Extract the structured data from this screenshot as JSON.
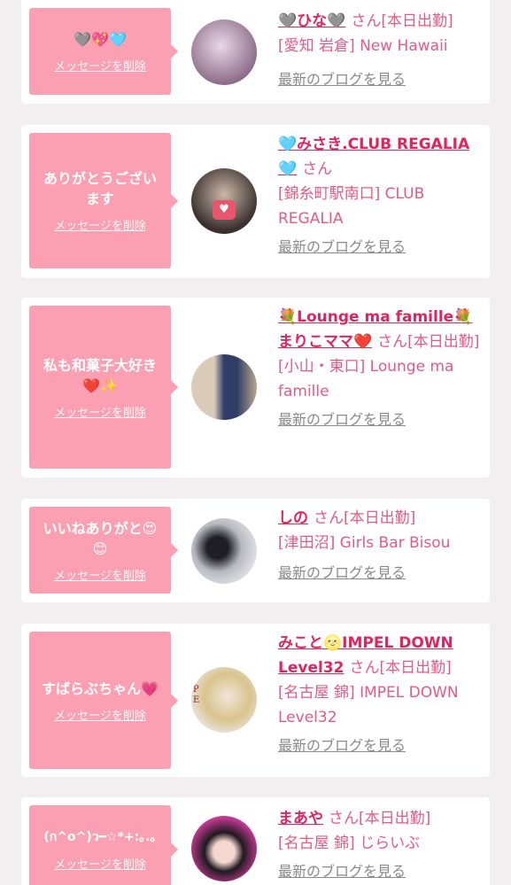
{
  "cards": [
    {
      "message": "🩶💖🩵",
      "delete": "メッセージを削除",
      "name": "🩶ひな🩶",
      "san": "さん",
      "status": "[本日出勤]",
      "shop": "[愛知 岩倉] New Hawaii",
      "blog": "最新のブログを見る",
      "avatar_color": "#b69bb4"
    },
    {
      "message": "ありがとうございます",
      "delete": "メッセージを削除",
      "name": "🩵みさき.CLUB REGALIA🩵",
      "san": "さん",
      "status": "",
      "shop": "[錦糸町駅南口] CLUB REGALIA",
      "blog": "最新のブログを見る",
      "avatar_color": "#4a4040"
    },
    {
      "message": "私も和菓子大好き❤️✨",
      "delete": "メッセージを削除",
      "name": "💐Lounge ma famille💐まりこママ❤️",
      "san": "さん",
      "status": "[本日出勤]",
      "shop": "[小山・東口] Lounge ma famille",
      "blog": "最新のブログを見る",
      "avatar_color": "#3b4a6e"
    },
    {
      "message": "いいねありがと😍😊",
      "delete": "メッセージを削除",
      "name": "しの",
      "san": "さん",
      "status": "[本日出勤]",
      "shop": "[津田沼] Girls Bar Bisou",
      "blog": "最新のブログを見る",
      "avatar_color": "#5a5a66"
    },
    {
      "message": "すばらぶちゃん💗",
      "delete": "メッセージを削除",
      "name": "みこと🌝IMPEL DOWN Level32",
      "san": "さん",
      "status": "[本日出勤]",
      "shop": "[名古屋 錦] IMPEL DOWN Level32",
      "blog": "最新のブログを見る",
      "avatar_color": "#d8cfc4"
    },
    {
      "message": "(ก^o^)ว━☆*+:｡.｡",
      "delete": "メッセージを削除",
      "name": "まあや",
      "san": "さん",
      "status": "[本日出勤]",
      "shop": "[名古屋 錦] じらいぶ",
      "blog": "最新のブログを見る",
      "avatar_color": "#c83a96"
    }
  ]
}
